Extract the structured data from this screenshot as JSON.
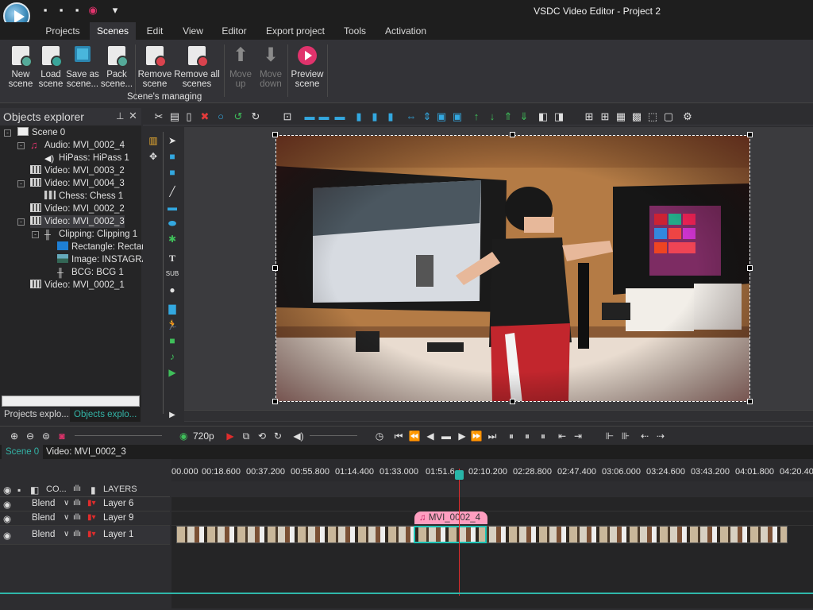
{
  "window": {
    "title": "VSDC Video Editor - Project 2"
  },
  "menu_tabs": [
    {
      "label": "Projects"
    },
    {
      "label": "Scenes"
    },
    {
      "label": "Edit"
    },
    {
      "label": "View"
    },
    {
      "label": "Editor"
    },
    {
      "label": "Export project"
    },
    {
      "label": "Tools"
    },
    {
      "label": "Activation"
    }
  ],
  "ribbon": {
    "buttons": [
      {
        "line1": "New",
        "line2": "scene"
      },
      {
        "line1": "Load",
        "line2": "scene"
      },
      {
        "line1": "Save as",
        "line2": "scene..."
      },
      {
        "line1": "Pack",
        "line2": "scene..."
      },
      {
        "line1": "Remove",
        "line2": "scene"
      },
      {
        "line1": "Remove all",
        "line2": "scenes"
      },
      {
        "line1": "Move",
        "line2": "up"
      },
      {
        "line1": "Move",
        "line2": "down"
      },
      {
        "line1": "Preview",
        "line2": "scene"
      }
    ],
    "group_label": "Scene's managing"
  },
  "explorer": {
    "title": "Objects explorer",
    "tree": [
      {
        "label": "Scene 0",
        "icon": "scene-icon"
      },
      {
        "label": "Audio: MVI_0002_4",
        "icon": "audio-icon"
      },
      {
        "label": "HiPass: HiPass 1",
        "icon": "speaker-icon"
      },
      {
        "label": "Video: MVI_0003_2",
        "icon": "film-icon"
      },
      {
        "label": "Video: MVI_0004_3",
        "icon": "film-icon"
      },
      {
        "label": "Chess: Chess 1",
        "icon": "chess-icon"
      },
      {
        "label": "Video: MVI_0002_2",
        "icon": "film-icon"
      },
      {
        "label": "Video: MVI_0002_3",
        "icon": "film-icon"
      },
      {
        "label": "Clipping: Clipping 1",
        "icon": "clipping-icon"
      },
      {
        "label": "Rectangle: Rectar",
        "icon": "rectangle-icon"
      },
      {
        "label": "Image: INSTAGRA",
        "icon": "image-icon"
      },
      {
        "label": "BCG: BCG 1",
        "icon": "bcg-icon"
      },
      {
        "label": "Video: MVI_0002_1",
        "icon": "film-icon"
      }
    ],
    "tabs": [
      {
        "label": "Projects explo..."
      },
      {
        "label": "Objects explo..."
      }
    ]
  },
  "palette": {
    "sub_label": "SUB"
  },
  "timeline_controls": {
    "resolution": "720p"
  },
  "scene_tabs": [
    {
      "label": "Scene 0"
    },
    {
      "label": "Video: MVI_0002_3"
    }
  ],
  "ruler": {
    "ticks": [
      "00.000",
      "00:18.600",
      "00:37.200",
      "00:55.800",
      "01:14.400",
      "01:33.000",
      "01:51.6",
      "02:10.200",
      "02:28.800",
      "02:47.400",
      "03:06.000",
      "03:24.600",
      "03:43.200",
      "04:01.800",
      "04:20.40"
    ]
  },
  "layer_header": {
    "co_label": "CO...",
    "layers_label": "LAYERS"
  },
  "layers": [
    {
      "blend": "Blend",
      "name": "Layer 6"
    },
    {
      "blend": "Blend",
      "name": "Layer 9"
    },
    {
      "blend": "Blend",
      "name": "Layer 1"
    }
  ],
  "clips": {
    "audio_clip_label": "MVI_0002_4"
  },
  "colors": {
    "accent": "#2fb7aa",
    "playhead": "#e02c2c",
    "record": "#e0336c"
  }
}
